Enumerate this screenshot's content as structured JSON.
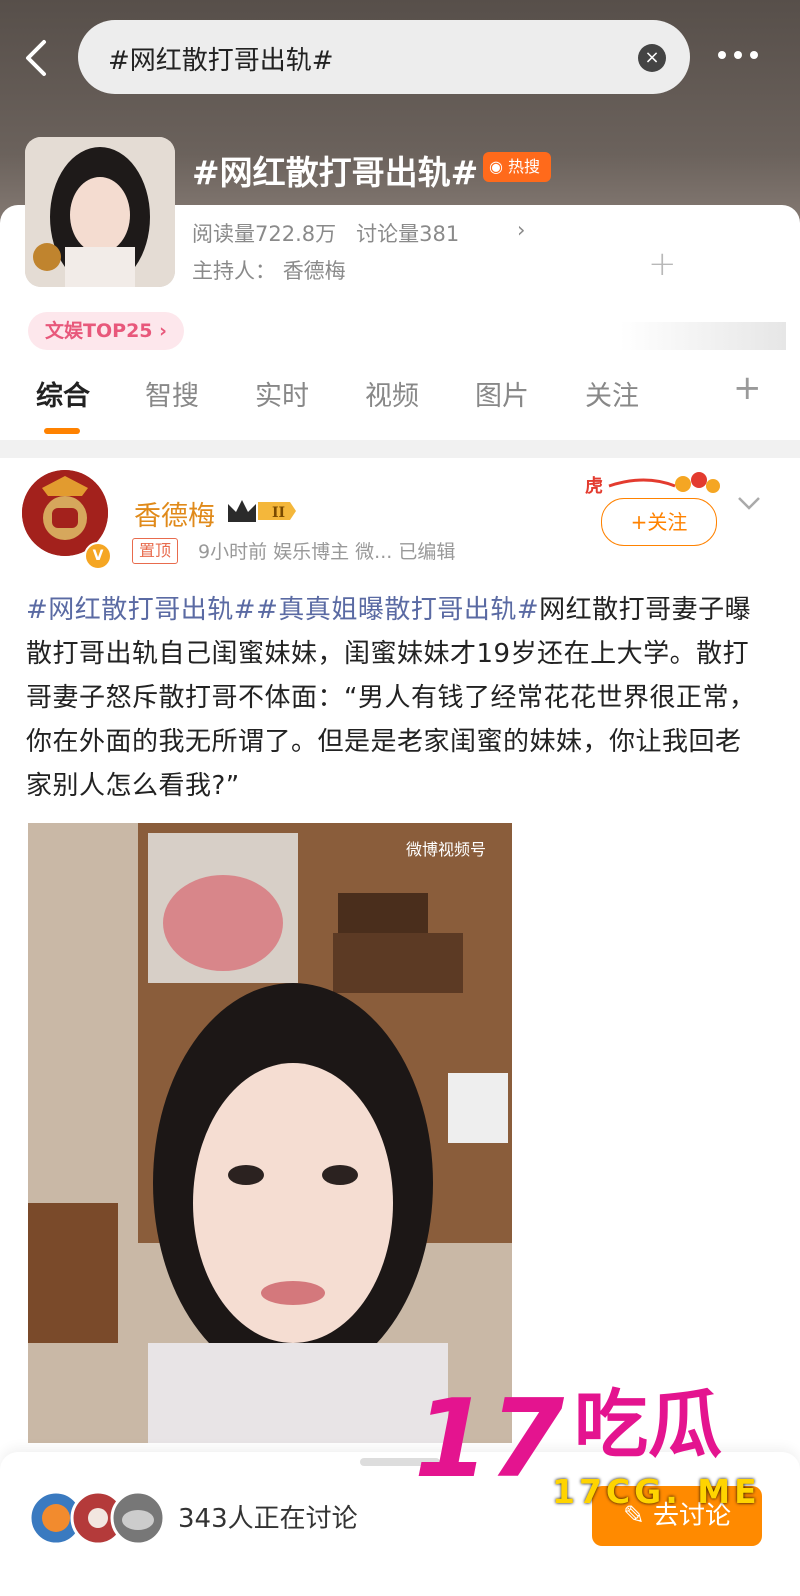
{
  "search": {
    "query": "#网红散打哥出轨#",
    "clear_icon": "close-icon"
  },
  "topic": {
    "title": "#网红散打哥出轨#",
    "hot_badge": "热搜",
    "reads_label": "阅读量722.8万",
    "discuss_label": "讨论量381",
    "chevron": "›",
    "host_label": "主持人：",
    "host_name": "香德梅",
    "plus": "+",
    "rank_badge": "文娱TOP25 ›"
  },
  "tabs": [
    {
      "label": "综合",
      "active": true
    },
    {
      "label": "智搜"
    },
    {
      "label": "实时"
    },
    {
      "label": "视频"
    },
    {
      "label": "图片"
    },
    {
      "label": "关注"
    }
  ],
  "tabs_plus": "+",
  "post": {
    "author": "香德梅",
    "pinned": "置顶",
    "meta": "9小时前  娱乐博主 微...  已编辑",
    "follow_label": "+关注",
    "tag1": "#网红散打哥出轨#",
    "tag2": "#真真姐曝散打哥出轨#",
    "body": "网红散打哥妻子曝散打哥出轨自己闺蜜妹妹，闺蜜妹妹才19岁还在上大学。散打哥妻子怒斥散打哥不体面：“男人有钱了经常花花世界很正常，你在外面的我无所谓了。但是是老家闺蜜的妹妹，你让我回老家别人怎么看我?”",
    "photo_watermark": "微博视频号"
  },
  "bottom": {
    "discuss_count": "343人正在讨论",
    "go_button": "去讨论"
  },
  "overlay": {
    "logo_num": "17",
    "logo_text": "吃瓜",
    "site": "17CG. ME"
  },
  "colors": {
    "accent": "#ff8200",
    "tag": "#5a6aa3",
    "hot": "#ff6a1b",
    "rank_text": "#e8587b",
    "overlay_pink": "#e4148f"
  }
}
